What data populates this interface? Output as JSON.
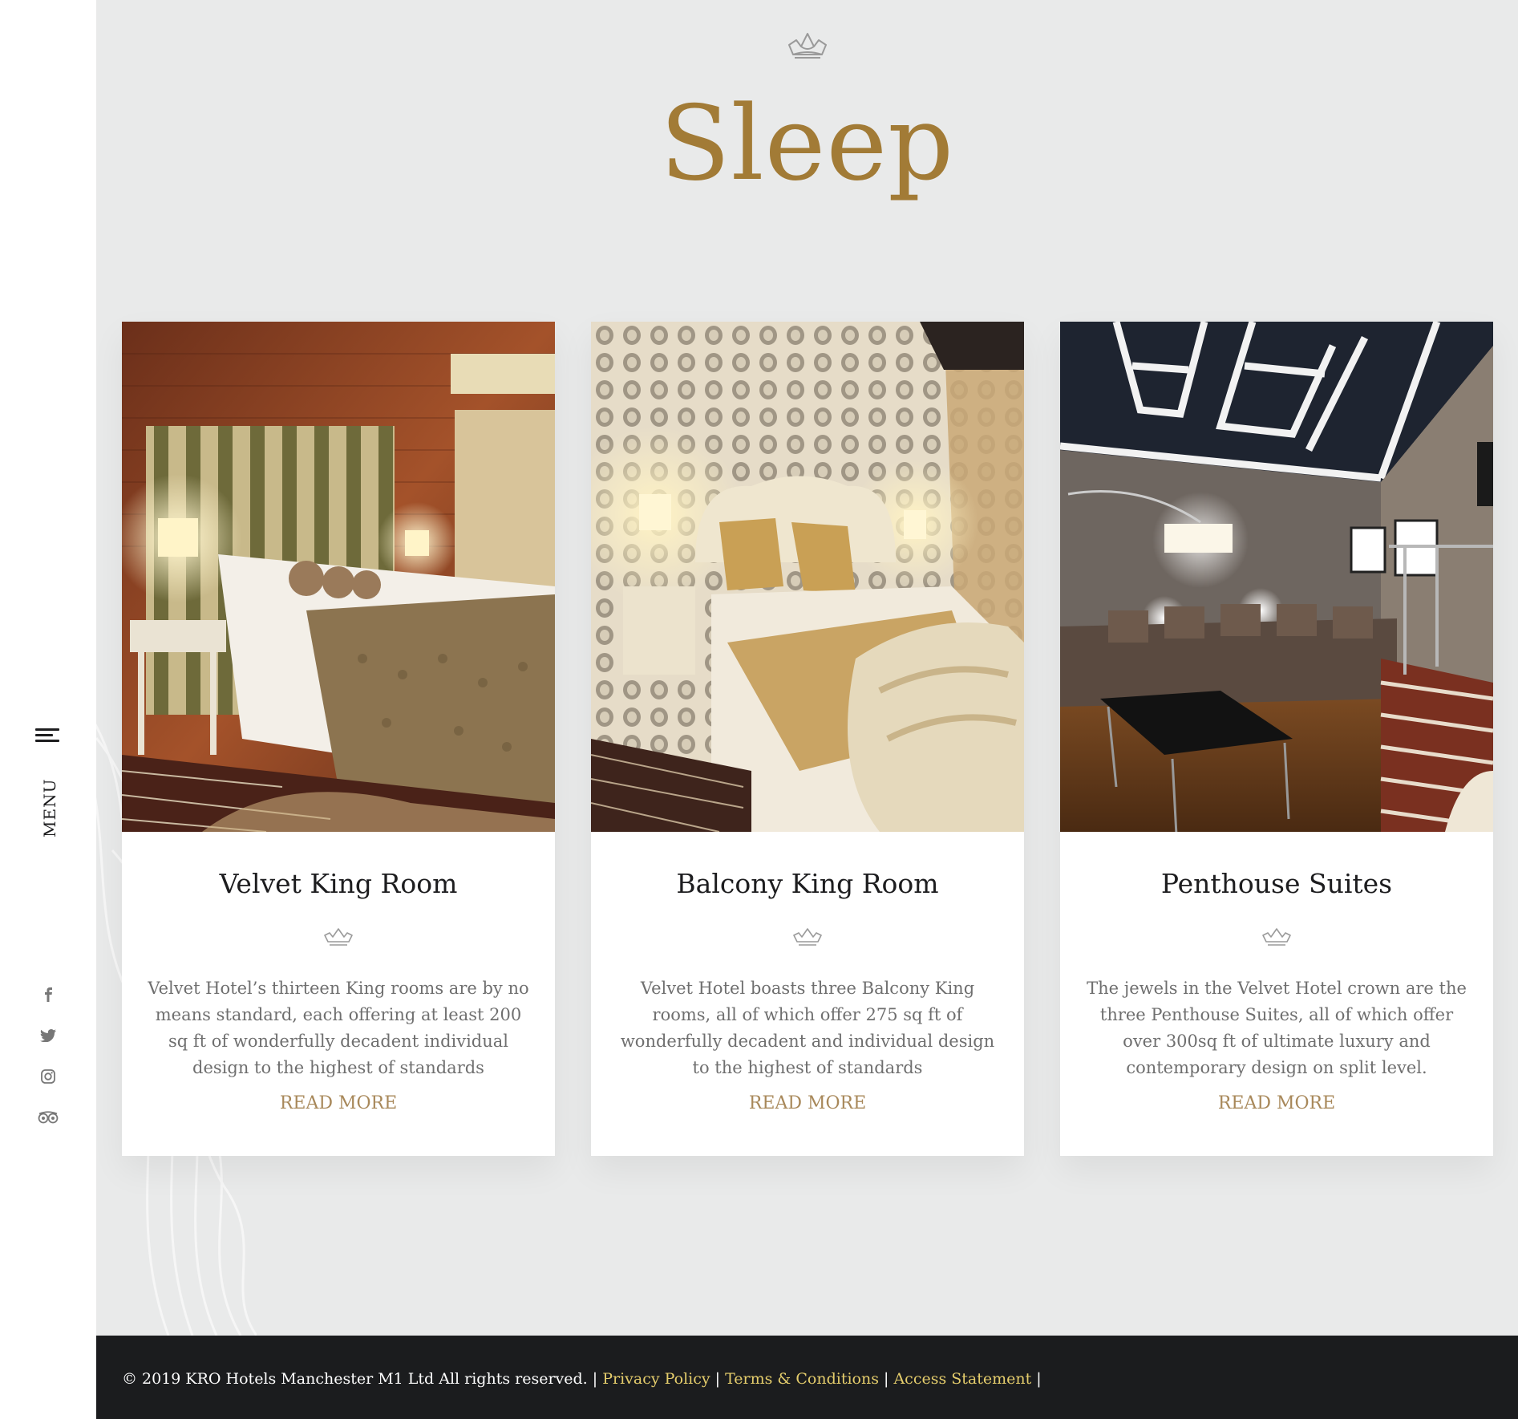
{
  "sidebar": {
    "menu_label": "MENU",
    "social": [
      {
        "icon": "facebook-icon"
      },
      {
        "icon": "twitter-icon"
      },
      {
        "icon": "instagram-icon"
      },
      {
        "icon": "tripadvisor-icon"
      }
    ]
  },
  "main": {
    "title": "Sleep",
    "read_more_label": "READ MORE",
    "rooms": [
      {
        "title": "Velvet King Room",
        "description": "Velvet Hotel’s thirteen King rooms are by no means standard, each offering at least 200 sq ft of wonderfully decadent individual design to the highest of standards",
        "link": "READ MORE"
      },
      {
        "title": "Balcony King Room",
        "description": "Velvet Hotel boasts three Balcony King rooms, all of which offer 275 sq ft of wonderfully decadent and individual design to the highest of standards",
        "link": "READ MORE"
      },
      {
        "title": "Penthouse Suites",
        "description": "The jewels in the Velvet Hotel crown are the three Penthouse Suites, all of which offer over 300sq ft of ultimate luxury and contemporary design on split level.",
        "link": "READ MORE"
      }
    ]
  },
  "footer": {
    "copyright": "© 2019 KRO Hotels Manchester M1 Ltd All rights reserved.",
    "separator": " | ",
    "links": [
      "Privacy Policy",
      "Terms & Conditions",
      "Access Statement"
    ],
    "trailing": " |"
  },
  "colors": {
    "accent_gold": "#a27b36",
    "link_gold": "#a8885a",
    "footer_link": "#e5cd6c",
    "main_bg": "#e9eaea",
    "footer_bg": "#1b1c1e"
  }
}
